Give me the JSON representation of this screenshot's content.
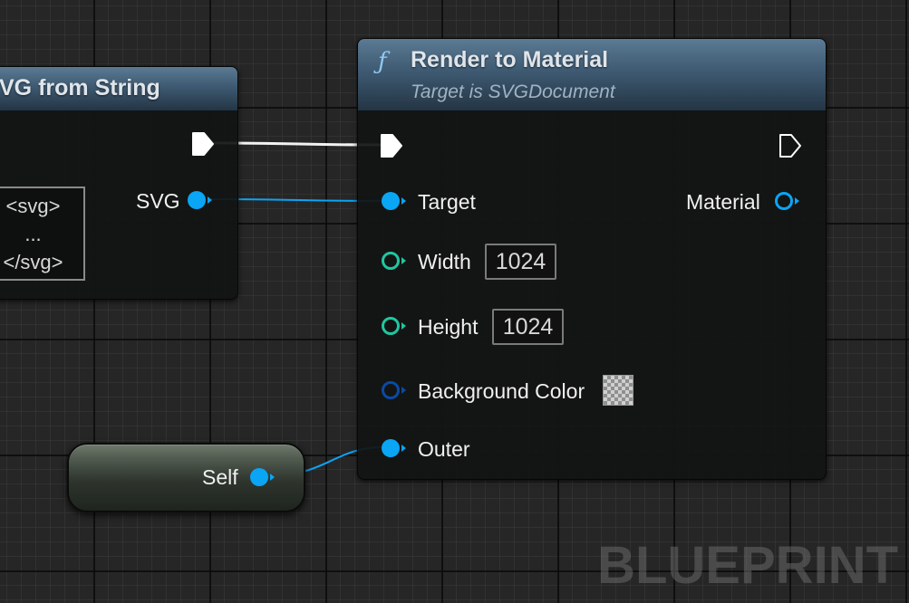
{
  "graph": {
    "watermark": "BLUEPRINT"
  },
  "svg_from_string_node": {
    "title": "VG from String",
    "output_pin_label": "SVG",
    "string_value_lines": [
      "<svg>",
      "...",
      "</svg>"
    ]
  },
  "render_node": {
    "icon": "function-icon",
    "title": "Render to Material",
    "subtitle": "Target is SVGDocument",
    "pins": {
      "target": "Target",
      "width": "Width",
      "width_value": "1024",
      "height": "Height",
      "height_value": "1024",
      "background_color": "Background Color",
      "outer": "Outer",
      "material": "Material"
    }
  },
  "self_node": {
    "label": "Self"
  },
  "colors": {
    "object_pin": "#0aa5f5",
    "int_pin": "#1fc7a0",
    "struct_pin": "#0a4aa6",
    "exec_pin": "#ffffff",
    "header_blue": "#3e5a72"
  }
}
